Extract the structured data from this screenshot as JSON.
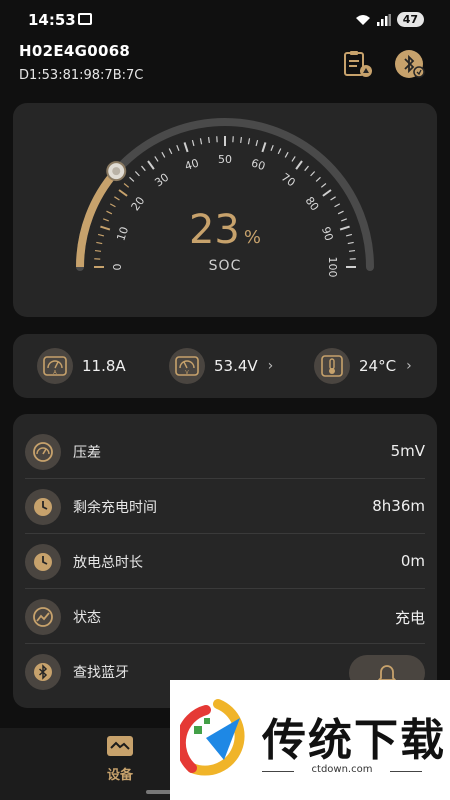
{
  "status_bar": {
    "time": "14:53",
    "battery": "47"
  },
  "header": {
    "device_id": "H02E4G0068",
    "mac": "D1:53:81:98:7B:7C",
    "report_icon": "report-clipboard-icon",
    "bluetooth_icon": "bluetooth-icon"
  },
  "gauge": {
    "value": "23",
    "unit": "%",
    "label": "SOC",
    "fraction": 0.23,
    "tick_labels": [
      "0",
      "10",
      "20",
      "30",
      "40",
      "50",
      "60",
      "70",
      "80",
      "90",
      "100"
    ],
    "active_color": "#c7a26c",
    "track_color": "#4a4a4a"
  },
  "metrics": [
    {
      "value": "11.8A",
      "icon": "ammeter-icon",
      "arrow": ""
    },
    {
      "value": "53.4V",
      "icon": "voltmeter-icon",
      "arrow": "›"
    },
    {
      "value": "24°C",
      "icon": "thermometer-icon",
      "arrow": "›"
    }
  ],
  "list": [
    {
      "label": "压差",
      "value": "5mV",
      "icon": "gauge-icon"
    },
    {
      "label": "剩余充电时间",
      "value": "8h36m",
      "icon": "clock-icon"
    },
    {
      "label": "放电总时长",
      "value": "0m",
      "icon": "clock-icon"
    },
    {
      "label": "状态",
      "value": "充电",
      "icon": "trend-icon"
    },
    {
      "label": "查找蓝牙",
      "value": "",
      "icon": "bluetooth-icon"
    }
  ],
  "nav": {
    "device_label": "设备"
  },
  "watermark": {
    "brand": "传统下载",
    "url": "ctdown.com"
  },
  "colors": {
    "accent": "#c7a26c",
    "card": "#262626",
    "background": "#101010"
  }
}
